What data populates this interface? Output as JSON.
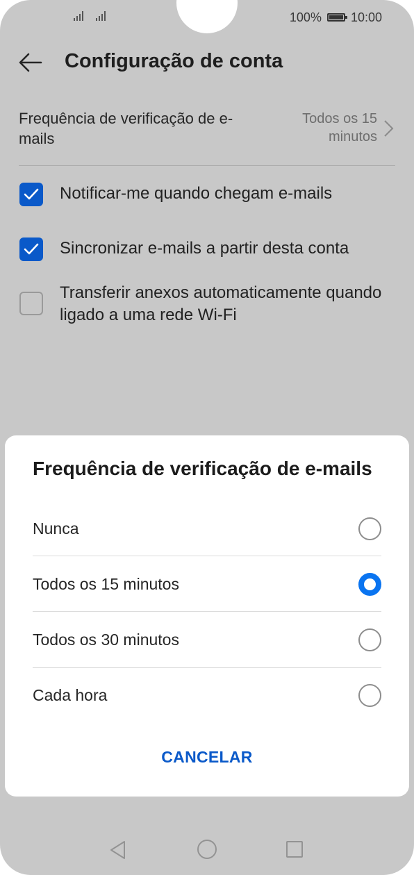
{
  "status_bar": {
    "battery_percent": "100%",
    "time": "10:00"
  },
  "header": {
    "title": "Configuração de conta"
  },
  "settings": {
    "check_frequency": {
      "label": "Frequência de verificação de e-mails",
      "value": "Todos os 15 minutos"
    },
    "checkboxes": [
      {
        "label": "Notificar-me quando chegam e-mails",
        "checked": true
      },
      {
        "label": "Sincronizar e-mails a partir desta conta",
        "checked": true
      },
      {
        "label": "Transferir anexos automaticamente quando ligado a uma rede Wi-Fi",
        "checked": false
      }
    ]
  },
  "dialog": {
    "title": "Frequência de verificação de e-mails",
    "options": [
      {
        "label": "Nunca",
        "selected": false
      },
      {
        "label": "Todos os 15 minutos",
        "selected": true
      },
      {
        "label": "Todos os 30 minutos",
        "selected": false
      },
      {
        "label": "Cada hora",
        "selected": false
      }
    ],
    "cancel_label": "CANCELAR"
  },
  "colors": {
    "accent": "#0a59c9",
    "radio_selected": "#0a74f0",
    "scrim": "#c8c8c8"
  }
}
